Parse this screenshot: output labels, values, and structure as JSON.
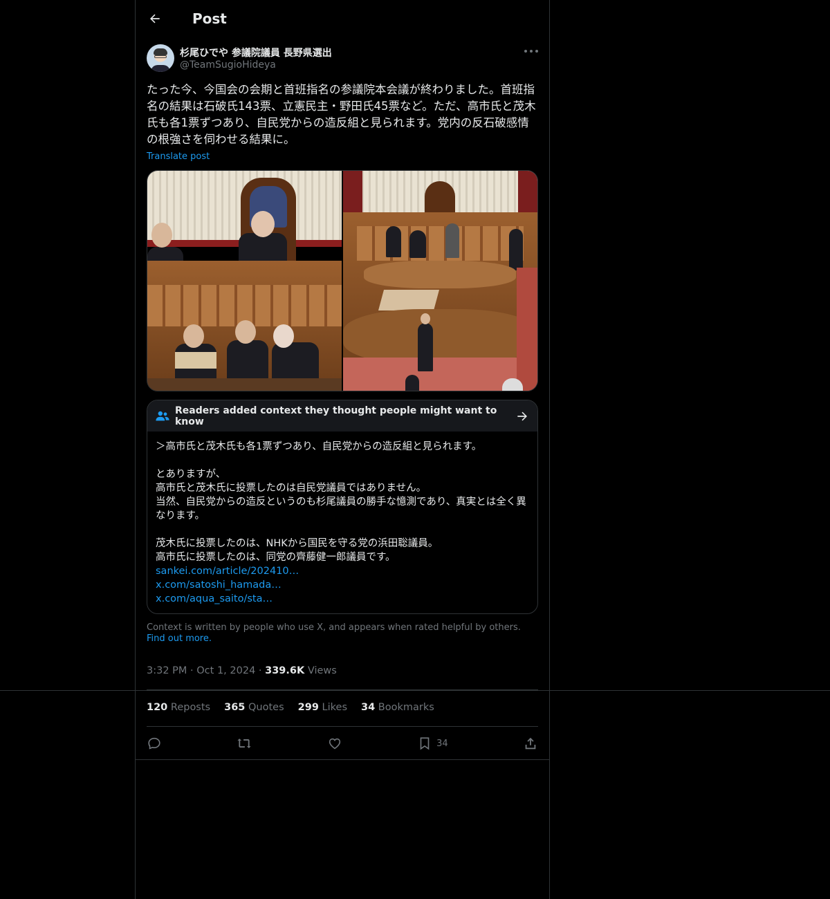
{
  "header": {
    "title": "Post"
  },
  "author": {
    "name": "杉尾ひでや 参議院議員 長野県選出",
    "handle": "@TeamSugioHideya"
  },
  "post": {
    "text": "たった今、今国会の会期と首班指名の参議院本会議が終わりました。首班指名の結果は石破氏143票、立憲民主・野田氏45票など。ただ、高市氏と茂木氏も各1票ずつあり、自民党からの造反組と見られます。党内の反石破感情の根強さを伺わせる結果に。",
    "translate_label": "Translate post"
  },
  "note": {
    "title": "Readers added context they thought people might want to know",
    "lines": [
      "＞高市氏と茂木氏も各1票ずつあり、自民党からの造反組と見られます。",
      "",
      "とありますが、",
      "高市氏と茂木氏に投票したのは自民党議員ではありません。",
      "当然、自民党からの造反というのも杉尾議員の勝手な憶測であり、真実とは全く異なります。",
      "",
      "茂木氏に投票したのは、NHKから国民を守る党の浜田聡議員。",
      "高市氏に投票したのは、同党の齊藤健一郎議員です。"
    ],
    "links": [
      "sankei.com/article/202410…",
      "x.com/satoshi_hamada…",
      "x.com/aqua_saito/sta…"
    ]
  },
  "context_footer": {
    "text": "Context is written by people who use X, and appears when rated helpful by others.",
    "link": "Find out more."
  },
  "meta": {
    "time": "3:32 PM",
    "date": "Oct 1, 2024",
    "views_count": "339.6K",
    "views_label": "Views"
  },
  "stats": {
    "reposts_count": "120",
    "reposts_label": "Reposts",
    "quotes_count": "365",
    "quotes_label": "Quotes",
    "likes_count": "299",
    "likes_label": "Likes",
    "bookmarks_count": "34",
    "bookmarks_label": "Bookmarks"
  },
  "actions": {
    "bookmark_count": "34"
  },
  "colors": {
    "accent": "#1d9bf0",
    "background": "#000000",
    "border": "#2f3336",
    "muted": "#71767b"
  }
}
